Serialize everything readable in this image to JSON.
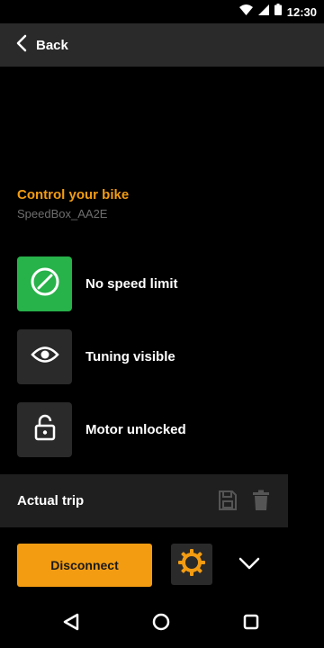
{
  "status_bar": {
    "time": "12:30",
    "icons": [
      "wifi-icon",
      "signal-icon",
      "battery-icon"
    ]
  },
  "header": {
    "back_label": "Back",
    "back_icon": "chevron-left-icon"
  },
  "control": {
    "title": "Control your bike",
    "device": "SpeedBox_AA2E",
    "items": [
      {
        "label": "No speed limit",
        "icon": "no-limit-icon",
        "active": true
      },
      {
        "label": "Tuning visible",
        "icon": "eye-icon",
        "active": false
      },
      {
        "label": "Motor unlocked",
        "icon": "unlock-icon",
        "active": false
      }
    ]
  },
  "trip": {
    "title": "Actual trip",
    "icons": [
      "save-icon",
      "trash-icon"
    ]
  },
  "actions": {
    "disconnect_label": "Disconnect",
    "settings_icon": "gear-icon",
    "expand_icon": "chevron-down-icon"
  },
  "nav": {
    "icons": [
      "back-triangle-icon",
      "home-circle-icon",
      "recents-square-icon"
    ]
  },
  "colors": {
    "accent": "#f39c12",
    "active_green": "#27b24a",
    "tile": "#2a2a2a",
    "background": "#000000"
  }
}
